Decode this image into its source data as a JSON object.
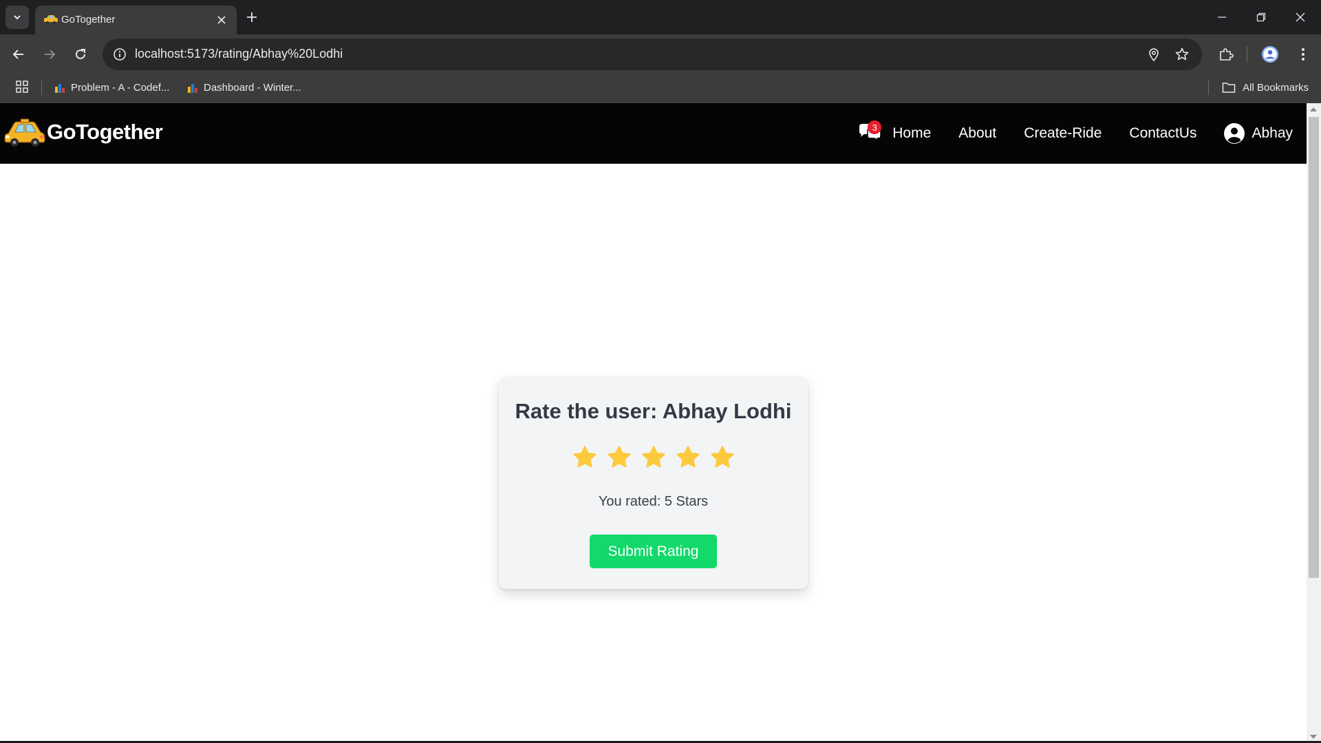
{
  "browser": {
    "tab_title": "GoTogether",
    "url": "localhost:5173/rating/Abhay%20Lodhi",
    "bookmarks": [
      {
        "label": "Problem - A - Codef..."
      },
      {
        "label": "Dashboard - Winter..."
      }
    ],
    "all_bookmarks_label": "All Bookmarks"
  },
  "navbar": {
    "brand": "GoTogether",
    "chat_badge_count": "3",
    "links": [
      "Home",
      "About",
      "Create-Ride",
      "ContactUs"
    ],
    "user_name": "Abhay"
  },
  "rating_card": {
    "title": "Rate the user: Abhay Lodhi",
    "stars_total": 5,
    "stars_selected": 5,
    "rated_text": "You rated: 5 Stars",
    "submit_label": "Submit Rating",
    "star_color": "#fcca3d",
    "button_color": "#13d96b"
  }
}
